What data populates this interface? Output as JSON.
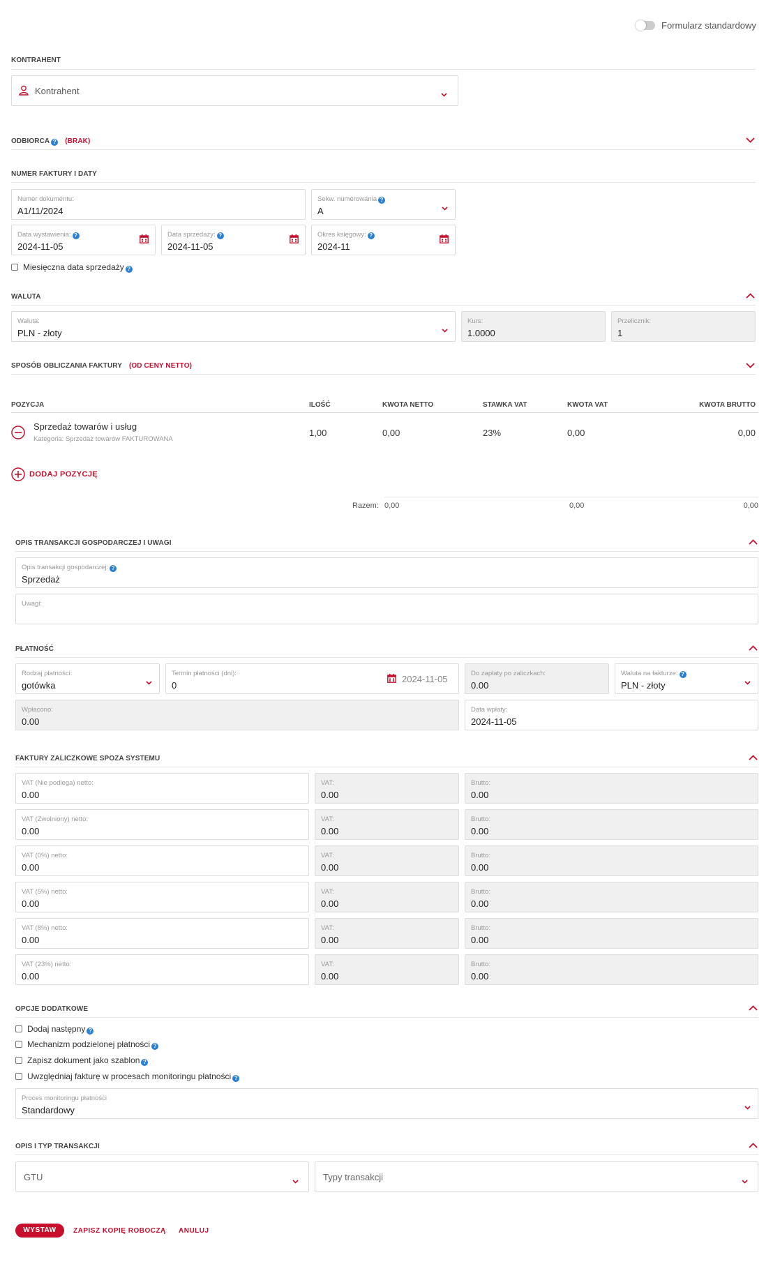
{
  "toggle": {
    "label": "Formularz standardowy"
  },
  "kontrahent": {
    "section": "KONTRAHENT",
    "placeholder": "Kontrahent"
  },
  "odbiorca": {
    "section": "ODBIORCA",
    "badge": "(BRAK)"
  },
  "numer": {
    "section": "NUMER FAKTURY I DATY",
    "doc_label": "Numer dokumentu:",
    "doc_value": "A1/11/2024",
    "seq_label": "Sekw. numerowania",
    "seq_value": "A",
    "issue_label": "Data wystawienia:",
    "issue_value": "2024-11-05",
    "sale_label": "Data sprzedaży:",
    "sale_value": "2024-11-05",
    "period_label": "Okres księgowy:",
    "period_value": "2024-11",
    "monthly_label": "Miesięczna data sprzedaży"
  },
  "waluta": {
    "section": "WALUTA",
    "currency_label": "Waluta:",
    "currency_value": "PLN - złoty",
    "rate_label": "Kurs:",
    "rate_value": "1.0000",
    "conv_label": "Przelicznik:",
    "conv_value": "1"
  },
  "sposob": {
    "section": "SPOSÓB OBLICZANIA FAKTURY",
    "badge": "(OD CENY NETTO)"
  },
  "items": {
    "headers": {
      "pos": "POZYCJA",
      "qty": "ILOŚĆ",
      "net": "KWOTA NETTO",
      "rate": "STAWKA VAT",
      "vat": "KWOTA VAT",
      "gross": "KWOTA BRUTTO"
    },
    "rows": [
      {
        "name": "Sprzedaż towarów i usług",
        "category": "Kategoria: Sprzedaż towarów FAKTUROWANA",
        "qty": "1,00",
        "net": "0,00",
        "rate": "23%",
        "vat": "0,00",
        "gross": "0,00"
      }
    ],
    "add_label": "DODAJ POZYCJĘ",
    "total_label": "Razem:",
    "total_net": "0,00",
    "total_vat": "0,00",
    "total_gross": "0,00"
  },
  "opis": {
    "section": "OPIS TRANSAKCJI GOSPODARCZEJ I UWAGI",
    "desc_label": "Opis transakcji gospodarczej:",
    "desc_value": "Sprzedaż",
    "notes_label": "Uwagi:"
  },
  "platnosc": {
    "section": "PŁATNOŚĆ",
    "type_label": "Rodzaj płatności:",
    "type_value": "gotówka",
    "term_label": "Termin płatności (dni):",
    "term_value": "0",
    "term_date": "2024-11-05",
    "due_label": "Do zapłaty po zaliczkach:",
    "due_value": "0.00",
    "invcur_label": "Waluta na fakturze:",
    "invcur_value": "PLN - złoty",
    "paid_label": "Wpłacono:",
    "paid_value": "0.00",
    "paydate_label": "Data wpłaty:",
    "paydate_value": "2024-11-05"
  },
  "zaliczki": {
    "section": "FAKTURY ZALICZKOWE SPOZA SYSTEMU",
    "vat_label": "VAT:",
    "gross_label": "Brutto:",
    "rows": [
      {
        "net_label": "VAT (Nie podlega) netto:",
        "net": "0.00",
        "vat": "0.00",
        "gross": "0.00"
      },
      {
        "net_label": "VAT (Zwolniony) netto:",
        "net": "0.00",
        "vat": "0.00",
        "gross": "0.00"
      },
      {
        "net_label": "VAT (0%) netto:",
        "net": "0.00",
        "vat": "0.00",
        "gross": "0.00"
      },
      {
        "net_label": "VAT (5%) netto:",
        "net": "0.00",
        "vat": "0.00",
        "gross": "0.00"
      },
      {
        "net_label": "VAT (8%) netto:",
        "net": "0.00",
        "vat": "0.00",
        "gross": "0.00"
      },
      {
        "net_label": "VAT (23%) netto:",
        "net": "0.00",
        "vat": "0.00",
        "gross": "0.00"
      }
    ]
  },
  "opcje": {
    "section": "OPCJE DODATKOWE",
    "options": [
      "Dodaj następny",
      "Mechanizm podzielonej płatności",
      "Zapisz dokument jako szablon",
      "Uwzględniaj fakturę w procesach monitoringu płatności"
    ],
    "process_label": "Proces monitoringu płatności",
    "process_value": "Standardowy"
  },
  "typ": {
    "section": "OPIS I TYP TRANSAKCJI",
    "gtu_placeholder": "GTU",
    "types_placeholder": "Typy transakcji"
  },
  "actions": {
    "issue": "WYSTAW",
    "draft": "ZAPISZ KOPIĘ ROBOCZĄ",
    "cancel": "ANULUJ"
  },
  "colors": {
    "accent": "#c8102e",
    "help": "#2a7fd4"
  }
}
